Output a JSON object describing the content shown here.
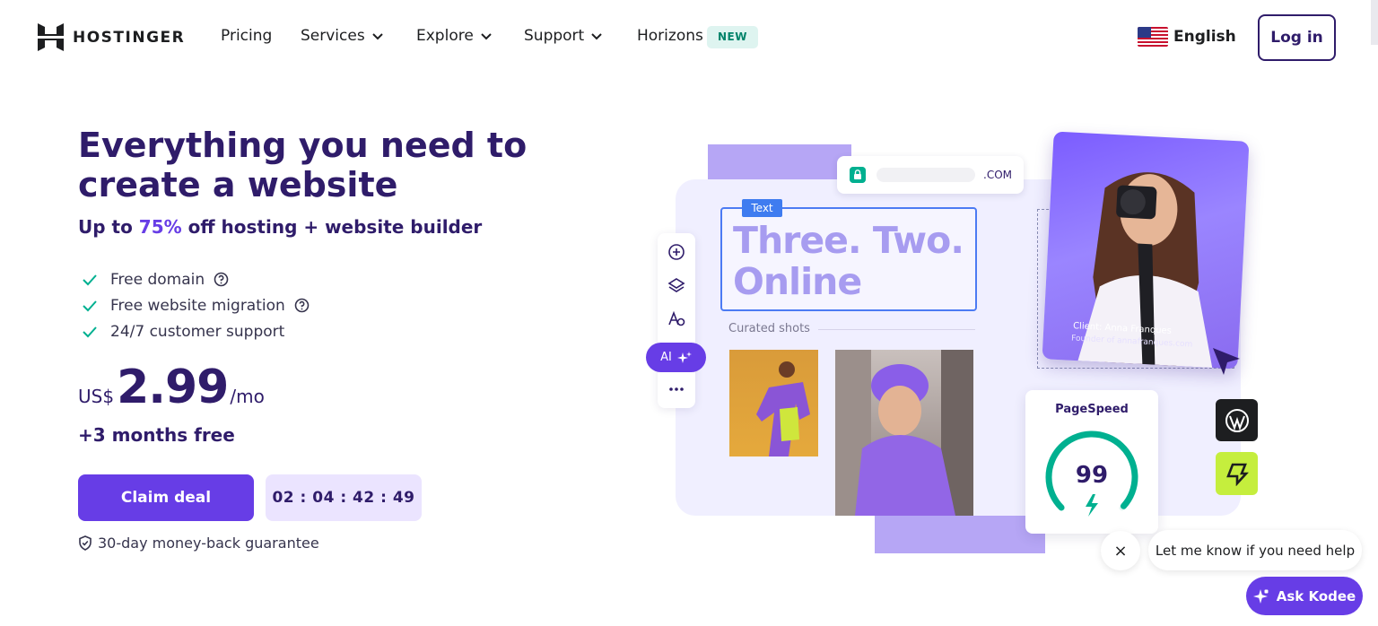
{
  "nav": {
    "brand": "HOSTINGER",
    "items": [
      {
        "label": "Pricing",
        "dropdown": false
      },
      {
        "label": "Services",
        "dropdown": true
      },
      {
        "label": "Explore",
        "dropdown": true
      },
      {
        "label": "Support",
        "dropdown": true
      },
      {
        "label": "Horizons",
        "dropdown": false
      }
    ],
    "new_badge": "NEW",
    "language": "English",
    "login": "Log in"
  },
  "hero": {
    "title": "Everything you need to create a website",
    "subtitle_prefix": "Up to ",
    "subtitle_percent": "75%",
    "subtitle_suffix": " off hosting + website builder",
    "features": [
      {
        "label": "Free domain",
        "help": true
      },
      {
        "label": "Free website migration",
        "help": true
      },
      {
        "label": "24/7 customer support",
        "help": false
      }
    ],
    "currency": "US$",
    "price": "2.99",
    "period": "/mo",
    "bonus": "+3 months free",
    "cta": "Claim deal",
    "timer": "02 : 04 : 42 : 49",
    "guarantee": "30-day money-back guarantee"
  },
  "illustration": {
    "domain_suffix": ".COM",
    "text_tag": "Text",
    "headline_line1": "Three. Two.",
    "headline_line2": "Online",
    "curated_label": "Curated shots",
    "ai_label": "AI",
    "client_name": "Client: Anna Franques",
    "client_role": "Founder of annafranques.com",
    "pagespeed_label": "PageSpeed",
    "pagespeed_score": "99",
    "pagespeed_fraction": 0.99
  },
  "chat": {
    "close": "×",
    "message": "Let me know if you need help",
    "ask_button": "Ask Kodee"
  },
  "colors": {
    "primary": "#673de6",
    "navy": "#2f1c6a",
    "success": "#00b090",
    "light_purple": "#ebe4ff"
  },
  "icons": [
    "hostinger-logo-icon",
    "chevron-down-icon",
    "us-flag-icon",
    "check-icon",
    "help-circle-icon",
    "shield-check-icon",
    "lock-icon",
    "plus-circle-icon",
    "layers-icon",
    "text-style-icon",
    "sparkle-icon",
    "more-icon",
    "cursor-icon",
    "bolt-icon",
    "wordpress-icon",
    "lightning-logo-icon",
    "close-icon",
    "kodee-icon"
  ]
}
